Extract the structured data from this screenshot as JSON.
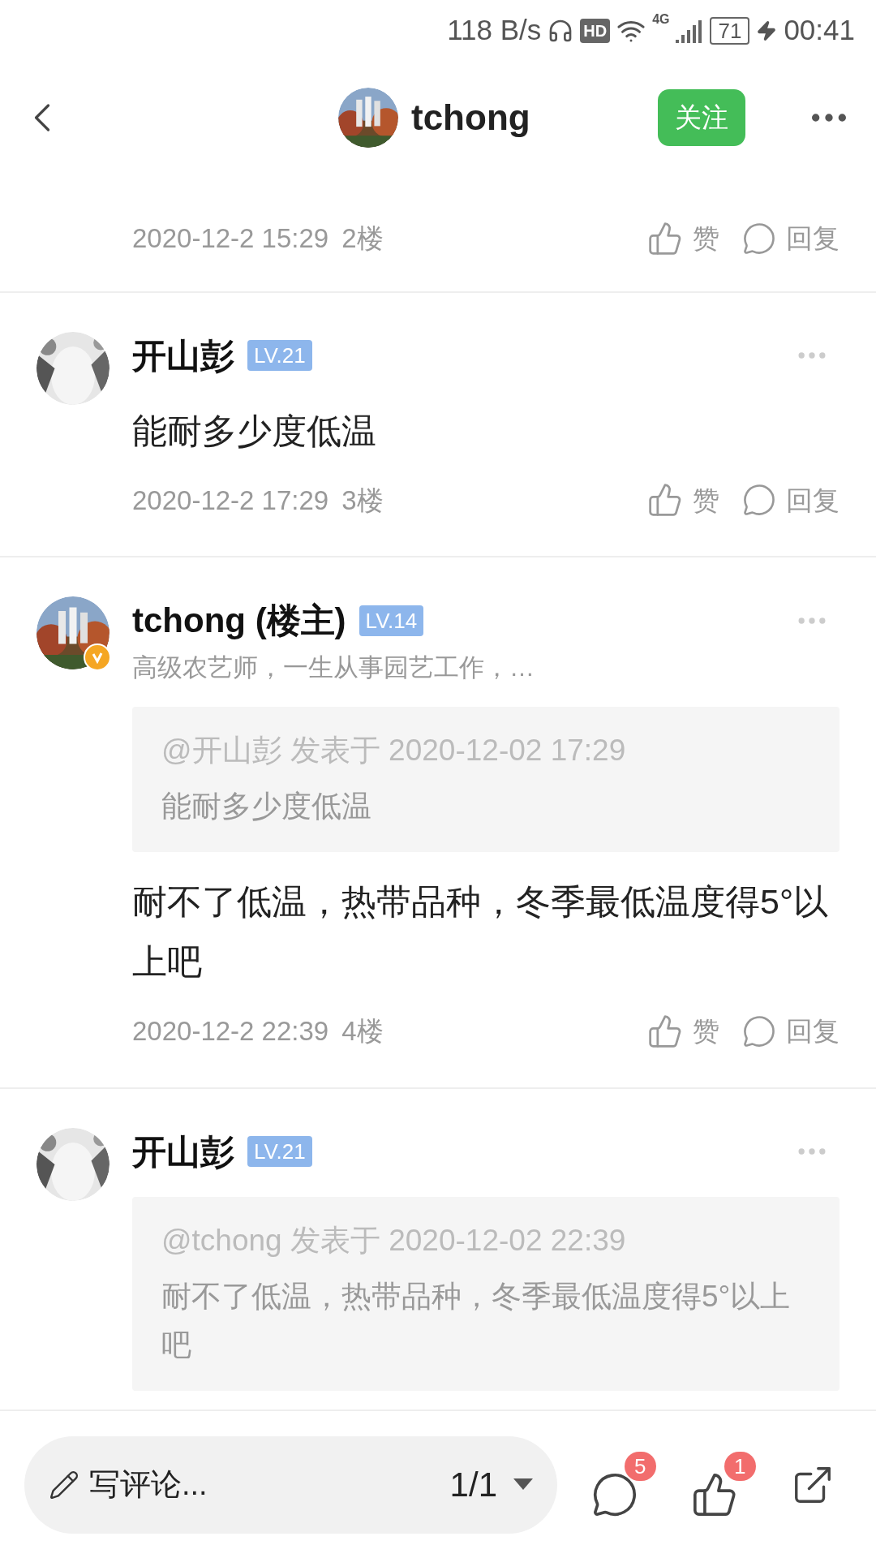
{
  "status_bar": {
    "speed": "118 B/s",
    "hd": "HD",
    "network": "4G",
    "battery": "71",
    "time": "00:41"
  },
  "header": {
    "title": "tchong",
    "follow_button": "关注"
  },
  "comments": [
    {
      "time": "2020-12-2 15:29",
      "floor": "2楼",
      "like_label": "赞",
      "reply_label": "回复"
    },
    {
      "author": "开山彭",
      "level_badge": "LV.21",
      "verified": false,
      "text": "能耐多少度低温",
      "time": "2020-12-2 17:29",
      "floor": "3楼",
      "like_label": "赞",
      "reply_label": "回复"
    },
    {
      "author": "tchong (楼主)",
      "level_badge": "LV.14",
      "verified": true,
      "bio": "高级农艺师，一生从事园艺工作，…",
      "quote": {
        "header": "@开山彭 发表于 2020-12-02 17:29",
        "text": "能耐多少度低温"
      },
      "text": "耐不了低温，热带品种，冬季最低温度得5°以上吧",
      "time": "2020-12-2 22:39",
      "floor": "4楼",
      "like_label": "赞",
      "reply_label": "回复"
    },
    {
      "author": "开山彭",
      "level_badge": "LV.21",
      "verified": false,
      "quote": {
        "header": "@tchong 发表于 2020-12-02 22:39",
        "text": "耐不了低温，热带品种，冬季最低温度得5°以上吧"
      }
    }
  ],
  "bottom_bar": {
    "comment_placeholder": "写评论...",
    "page": "1/1",
    "comment_count": "5",
    "like_count": "1"
  }
}
